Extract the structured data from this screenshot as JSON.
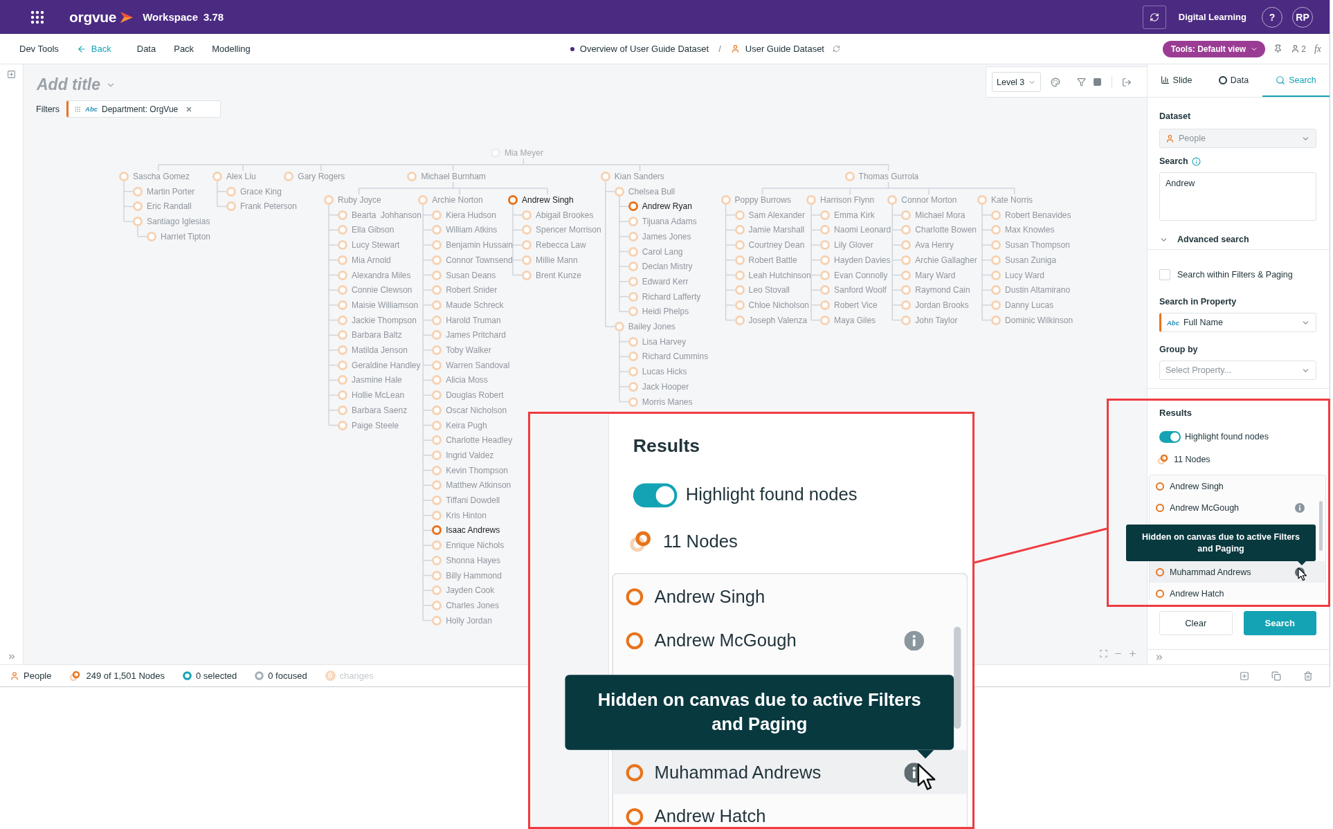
{
  "header": {
    "brand": "orgvue",
    "workspace": "Workspace",
    "version": "3.78",
    "account": "Digital Learning",
    "help": "?",
    "avatar": "RP"
  },
  "nav": {
    "items": [
      {
        "label": "Dev Tools",
        "kind": "link"
      },
      {
        "label": "Back",
        "kind": "back"
      },
      {
        "label": "Data",
        "kind": "link"
      },
      {
        "label": "Pack",
        "kind": "link"
      },
      {
        "label": "Modelling",
        "kind": "link"
      }
    ],
    "breadcrumb": {
      "parent": "Overview of User Guide Dataset",
      "separator": "/",
      "current": "User Guide Dataset"
    },
    "view_button": "Tools: Default view",
    "collaborators": "2",
    "formula": "fx"
  },
  "canvas": {
    "title_placeholder": "Add title",
    "filters_label": "Filters",
    "filter_chip": {
      "type": "Abc",
      "label": "Department: OrgVue"
    },
    "level": "Level 3",
    "tree": {
      "root": "Mia Meyer",
      "children": [
        {
          "name": "Sascha Gomez",
          "found": false,
          "children": [
            {
              "name": "Martin Porter",
              "found": false
            },
            {
              "name": "Eric Randall",
              "found": false
            },
            {
              "name": "Santiago Iglesias",
              "found": false,
              "children": [
                {
                  "name": "Harriet Tipton",
                  "found": false
                }
              ]
            }
          ]
        },
        {
          "name": "Alex Liu",
          "found": false,
          "children": [
            {
              "name": "Grace King",
              "found": false
            },
            {
              "name": "Frank Peterson",
              "found": false
            }
          ]
        },
        {
          "name": "Gary Rogers",
          "found": false
        },
        {
          "name": "Michael Burnham",
          "found": false,
          "children": [
            {
              "name": "Ruby Joyce",
              "found": false,
              "children": [
                {
                  "name": "Bearta  Johhanson",
                  "found": false
                },
                {
                  "name": "Ella Gibson",
                  "found": false
                },
                {
                  "name": "Lucy Stewart",
                  "found": false
                },
                {
                  "name": "Mia Arnold",
                  "found": false
                },
                {
                  "name": "Alexandra Miles",
                  "found": false
                },
                {
                  "name": "Connie Clewson",
                  "found": false
                },
                {
                  "name": "Maisie Williamson",
                  "found": false
                },
                {
                  "name": "Jackie Thompson",
                  "found": false
                },
                {
                  "name": "Barbara Baltz",
                  "found": false
                },
                {
                  "name": "Matilda Jenson",
                  "found": false
                },
                {
                  "name": "Geraldine Handley",
                  "found": false
                },
                {
                  "name": "Jasmine Hale",
                  "found": false
                },
                {
                  "name": "Hollie McLean",
                  "found": false
                },
                {
                  "name": "Barbara Saenz",
                  "found": false
                },
                {
                  "name": "Paige Steele",
                  "found": false
                }
              ]
            },
            {
              "name": "Archie Norton",
              "found": false,
              "children": [
                {
                  "name": "Kiera Hudson",
                  "found": false
                },
                {
                  "name": "William Atkins",
                  "found": false
                },
                {
                  "name": "Benjamin Hussain",
                  "found": false
                },
                {
                  "name": "Connor Townsend",
                  "found": false
                },
                {
                  "name": "Susan Deans",
                  "found": false
                },
                {
                  "name": "Robert Snider",
                  "found": false
                },
                {
                  "name": "Maude Schreck",
                  "found": false
                },
                {
                  "name": "Harold Truman",
                  "found": false
                },
                {
                  "name": "James Pritchard",
                  "found": false
                },
                {
                  "name": "Toby Walker",
                  "found": false
                },
                {
                  "name": "Warren Sandoval",
                  "found": false
                },
                {
                  "name": "Alicia Moss",
                  "found": false
                },
                {
                  "name": "Douglas Robert",
                  "found": false
                },
                {
                  "name": "Oscar Nicholson",
                  "found": false
                },
                {
                  "name": "Keira Pugh",
                  "found": false
                },
                {
                  "name": "Charlotte Headley",
                  "found": false
                },
                {
                  "name": "Ingrid Valdez",
                  "found": false
                },
                {
                  "name": "Kevin Thompson",
                  "found": false
                },
                {
                  "name": "Matthew Atkinson",
                  "found": false
                },
                {
                  "name": "Tiffani Dowdell",
                  "found": false
                },
                {
                  "name": "Kris Hinton",
                  "found": false
                },
                {
                  "name": "Isaac Andrews",
                  "found": true
                },
                {
                  "name": "Enrique Nichols",
                  "found": false
                },
                {
                  "name": "Shonna Hayes",
                  "found": false
                },
                {
                  "name": "Billy Hammond",
                  "found": false
                },
                {
                  "name": "Jayden Cook",
                  "found": false
                },
                {
                  "name": "Charles Jones",
                  "found": false
                },
                {
                  "name": "Holly Jordan",
                  "found": false
                }
              ]
            },
            {
              "name": "Andrew Singh",
              "found": true,
              "children": [
                {
                  "name": "Abigail Brookes",
                  "found": false
                },
                {
                  "name": "Spencer Morrison",
                  "found": false
                },
                {
                  "name": "Rebecca Law",
                  "found": false
                },
                {
                  "name": "Millie Mann",
                  "found": false
                },
                {
                  "name": "Brent Kunze",
                  "found": false
                }
              ]
            }
          ]
        },
        {
          "name": "Kian Sanders",
          "found": false,
          "children": [
            {
              "name": "Chelsea Bull",
              "found": false,
              "children": [
                {
                  "name": "Andrew Ryan",
                  "found": true
                },
                {
                  "name": "Tijuana Adams",
                  "found": false
                },
                {
                  "name": "James Jones",
                  "found": false
                },
                {
                  "name": "Carol Lang",
                  "found": false
                },
                {
                  "name": "Declan Mistry",
                  "found": false
                },
                {
                  "name": "Edward Kerr",
                  "found": false
                },
                {
                  "name": "Richard Lafferty",
                  "found": false
                },
                {
                  "name": "Heidi Phelps",
                  "found": false
                }
              ]
            },
            {
              "name": "Bailey Jones",
              "found": false,
              "children": [
                {
                  "name": "Lisa Harvey",
                  "found": false
                },
                {
                  "name": "Richard Cummins",
                  "found": false
                },
                {
                  "name": "Lucas Hicks",
                  "found": false
                },
                {
                  "name": "Jack Hooper",
                  "found": false
                },
                {
                  "name": "Morris Manes",
                  "found": false
                }
              ]
            }
          ]
        },
        {
          "name": "Thomas Gurrola",
          "found": false,
          "children": [
            {
              "name": "Poppy Burrows",
              "found": false,
              "children": [
                {
                  "name": "Sam Alexander",
                  "found": false
                },
                {
                  "name": "Jamie Marshall",
                  "found": false
                },
                {
                  "name": "Courtney Dean",
                  "found": false
                },
                {
                  "name": "Robert Battle",
                  "found": false
                },
                {
                  "name": "Leah Hutchinson",
                  "found": false
                },
                {
                  "name": "Leo Stovall",
                  "found": false
                },
                {
                  "name": "Chloe Nicholson",
                  "found": false
                },
                {
                  "name": "Joseph Valenza",
                  "found": false
                }
              ]
            },
            {
              "name": "Harrison Flynn",
              "found": false,
              "children": [
                {
                  "name": "Emma Kirk",
                  "found": false
                },
                {
                  "name": "Naomi Leonard",
                  "found": false
                },
                {
                  "name": "Lily Glover",
                  "found": false
                },
                {
                  "name": "Hayden Davies",
                  "found": false
                },
                {
                  "name": "Evan Connolly",
                  "found": false
                },
                {
                  "name": "Sanford Woolf",
                  "found": false
                },
                {
                  "name": "Robert Vice",
                  "found": false
                },
                {
                  "name": "Maya Giles",
                  "found": false
                }
              ]
            },
            {
              "name": "Connor Morton",
              "found": false,
              "children": [
                {
                  "name": "Michael Mora",
                  "found": false
                },
                {
                  "name": "Charlotte Bowen",
                  "found": false
                },
                {
                  "name": "Ava Henry",
                  "found": false
                },
                {
                  "name": "Archie Gallagher",
                  "found": false
                },
                {
                  "name": "Mary Ward",
                  "found": false
                },
                {
                  "name": "Raymond Cain",
                  "found": false
                },
                {
                  "name": "Jordan Brooks",
                  "found": false
                },
                {
                  "name": "John Taylor",
                  "found": false
                }
              ]
            },
            {
              "name": "Kate Norris",
              "found": false,
              "children": [
                {
                  "name": "Robert Benavides",
                  "found": false
                },
                {
                  "name": "Max Knowles",
                  "found": false
                },
                {
                  "name": "Susan Thompson",
                  "found": false
                },
                {
                  "name": "Susan Zuniga",
                  "found": false
                },
                {
                  "name": "Lucy Ward",
                  "found": false
                },
                {
                  "name": "Dustin Altamirano",
                  "found": false
                },
                {
                  "name": "Danny Lucas",
                  "found": false
                },
                {
                  "name": "Dominic Wilkinson",
                  "found": false
                }
              ]
            }
          ]
        }
      ]
    }
  },
  "search_panel": {
    "tabs": [
      {
        "label": "Slide",
        "kind": "slide",
        "selected": false
      },
      {
        "label": "Data",
        "kind": "data",
        "selected": false
      },
      {
        "label": "Search",
        "kind": "search",
        "selected": true
      }
    ],
    "dataset_label": "Dataset",
    "dataset": "People",
    "search_label": "Search",
    "search_value": "Andrew",
    "advanced": {
      "label": "Advanced search",
      "expanded": true
    },
    "within_filters": {
      "label": "Search within Filters & Paging",
      "checked": false
    },
    "property_label": "Search in Property",
    "property": {
      "type": "Abc",
      "value": "Full Name"
    },
    "group_label": "Group by",
    "group_placeholder": "Select Property...",
    "results": {
      "title": "Results",
      "highlight": {
        "label": "Highlight found nodes",
        "on": true
      },
      "count": "11 Nodes",
      "items": [
        {
          "name": "Andrew Singh",
          "hidden": false,
          "hovered": false
        },
        {
          "name": "Andrew McGough",
          "hidden": true,
          "hovered": false
        },
        {
          "name": "Muhammad Andrews",
          "hidden": true,
          "hovered": true
        },
        {
          "name": "Andrew Hatch",
          "hidden": false,
          "hovered": false
        }
      ],
      "tooltip": "Hidden on canvas due to active Filters and Paging"
    },
    "buttons": {
      "clear": "Clear",
      "search": "Search"
    }
  },
  "status_bar": {
    "dataset": "People",
    "nodes": "249 of 1,501 Nodes",
    "selected": "0 selected",
    "focused": "0 focused",
    "changes_count": "0",
    "changes": "changes"
  },
  "callout": {
    "title": "Results",
    "highlight": {
      "label": "Highlight found nodes",
      "on": true
    },
    "count": "11 Nodes",
    "items": [
      {
        "name": "Andrew Singh",
        "hidden": false,
        "hovered": false
      },
      {
        "name": "Andrew McGough",
        "hidden": true,
        "hovered": false
      },
      {
        "name": "Muhammad Andrews",
        "hidden": true,
        "hovered": true
      },
      {
        "name": "Andrew Hatch",
        "hidden": false,
        "hovered": false
      }
    ],
    "tooltip": "Hidden on canvas due to active Filters and Paging"
  }
}
